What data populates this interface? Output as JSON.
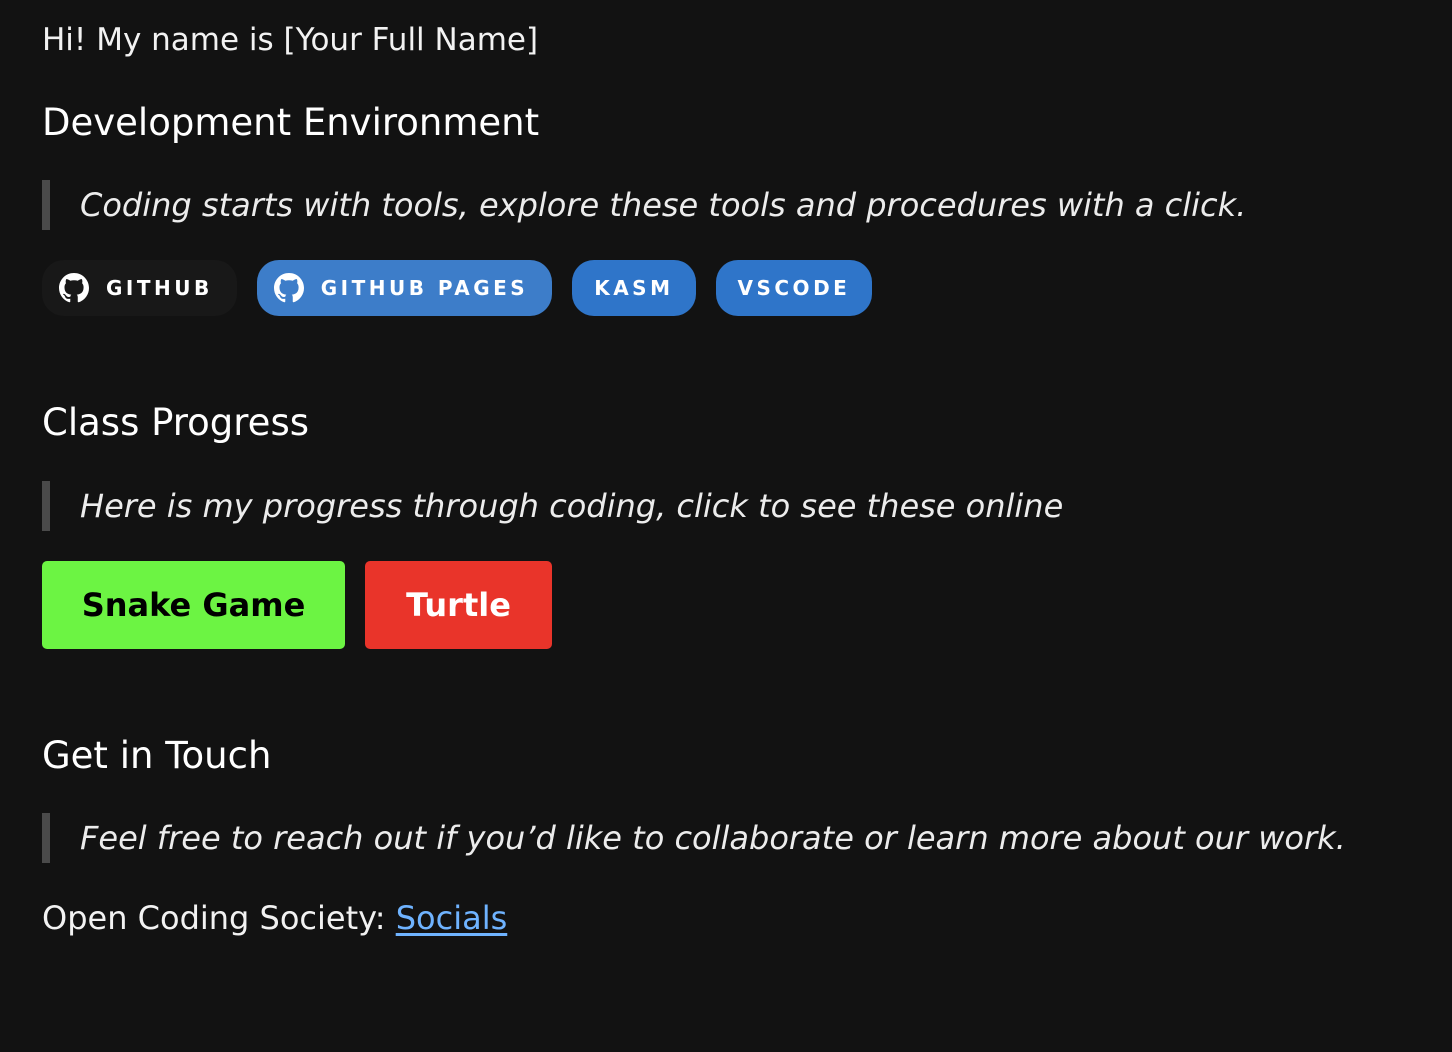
{
  "intro": {
    "text": "Hi! My name is [Your Full Name]"
  },
  "dev_env": {
    "heading": "Development Environment",
    "quote": "Coding starts with tools, explore these tools and procedures with a click.",
    "badges": [
      {
        "label": "GITHUB",
        "icon": "github-icon",
        "color": "#181818"
      },
      {
        "label": "GITHUB PAGES",
        "icon": "github-icon",
        "color": "#3d7dc9"
      },
      {
        "label": "KASM",
        "color": "#2f75c9"
      },
      {
        "label": "VSCODE",
        "color": "#2f75c9"
      }
    ]
  },
  "class_progress": {
    "heading": "Class Progress",
    "quote": "Here is my progress through coding, click to see these online",
    "buttons": [
      {
        "label": "Snake Game",
        "color": "#6cf443"
      },
      {
        "label": "Turtle",
        "color": "#e9342a"
      }
    ]
  },
  "contact": {
    "heading": "Get in Touch",
    "quote": "Feel free to reach out if you’d like to collaborate or learn more about our work.",
    "society_label": "Open Coding Society: ",
    "socials_link": "Socials",
    "link_color": "#6fb3ff"
  }
}
